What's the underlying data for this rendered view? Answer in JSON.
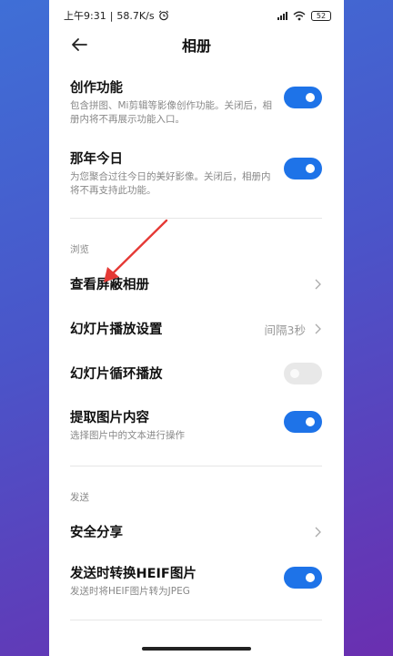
{
  "statusbar": {
    "time": "上午9:31",
    "separator": "|",
    "speed": "58.7K/s",
    "battery": "52"
  },
  "header": {
    "title": "相册"
  },
  "settings": [
    {
      "title": "创作功能",
      "desc": "包含拼图、Mi剪辑等影像创作功能。关闭后，相册内将不再展示功能入口。",
      "toggle": true
    },
    {
      "title": "那年今日",
      "desc": "为您聚合过往今日的美好影像。关闭后，相册内将不再支持此功能。",
      "toggle": true
    }
  ],
  "browse": {
    "section": "浏览",
    "items": [
      {
        "title": "查看屏蔽相册",
        "type": "link"
      },
      {
        "title": "幻灯片播放设置",
        "type": "link",
        "value": "间隔3秒"
      },
      {
        "title": "幻灯片循环播放",
        "type": "toggle",
        "toggle": false
      },
      {
        "title": "提取图片内容",
        "desc": "选择图片中的文本进行操作",
        "type": "toggle",
        "toggle": true
      }
    ]
  },
  "send": {
    "section": "发送",
    "items": [
      {
        "title": "安全分享",
        "type": "link"
      },
      {
        "title": "发送时转换HEIF图片",
        "desc": "发送时将HEIF图片转为JPEG",
        "type": "toggle",
        "toggle": true
      }
    ]
  },
  "colors": {
    "accent": "#1e73e8",
    "annotation_arrow": "#e53935"
  },
  "icons": [
    "back-arrow-icon",
    "chevron-right-icon",
    "alarm-icon",
    "signal-icon",
    "wifi-icon",
    "battery-icon"
  ]
}
